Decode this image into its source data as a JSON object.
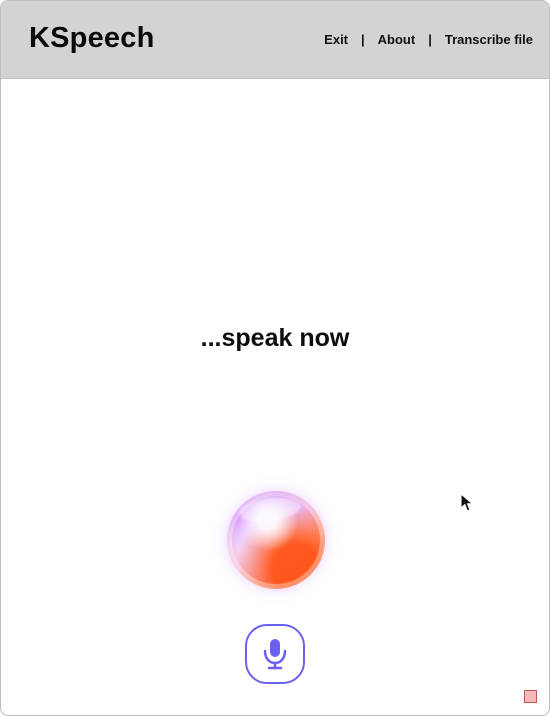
{
  "app": {
    "title": "KSpeech"
  },
  "nav": {
    "items": [
      {
        "label": "Exit"
      },
      {
        "label": "About"
      },
      {
        "label": "Transcribe file"
      }
    ],
    "separator": "|"
  },
  "main": {
    "status_text": "...speak now"
  },
  "icons": {
    "orb": "voice-orb",
    "microphone": "microphone-icon",
    "cursor": "mouse-pointer",
    "corner_box": "resize-indicator"
  },
  "colors": {
    "header_bg": "#d3d3d3",
    "accent": "#6b61f0",
    "orb_purple": "#c173ff",
    "orb_orange": "#ff5a1f",
    "corner_box": "#f7b8b8"
  }
}
